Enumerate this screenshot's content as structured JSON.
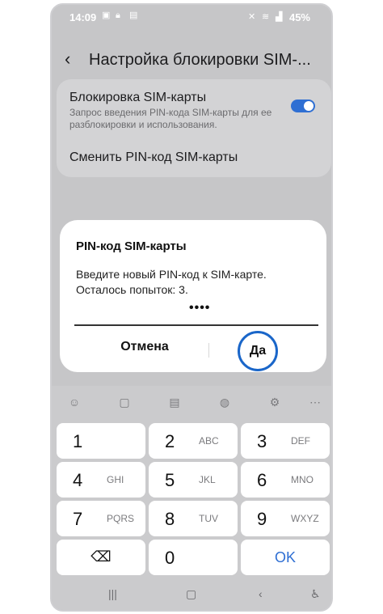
{
  "status": {
    "time": "14:09",
    "battery": "45%",
    "left_icons": [
      "sim-icon",
      "lock-icon",
      "image-icon"
    ],
    "right_icons": [
      "mute-icon",
      "wifi-icon",
      "signal-icon"
    ]
  },
  "header": {
    "title": "Настройка блокировки SIM-..."
  },
  "settings": {
    "lock_title": "Блокировка SIM-карты",
    "lock_sub": "Запрос введения PIN-кода SIM-карты для ее разблокировки и использования.",
    "change_pin": "Сменить PIN-код SIM-карты",
    "lock_enabled": true
  },
  "dialog": {
    "title": "PIN-код SIM-карты",
    "message_line1": "Введите новый PIN-код к SIM-карте.",
    "message_line2": "Осталось попыток: 3.",
    "pin_value": "••••",
    "cancel_label": "Отмена",
    "ok_label": "Да"
  },
  "keyboard": {
    "tools": [
      "emoji-icon",
      "clipboard-icon",
      "text-icon",
      "mic-icon",
      "settings-icon",
      "more-icon"
    ],
    "keys": [
      {
        "num": "1",
        "letters": ""
      },
      {
        "num": "2",
        "letters": "ABC"
      },
      {
        "num": "3",
        "letters": "DEF"
      },
      {
        "num": "4",
        "letters": "GHI"
      },
      {
        "num": "5",
        "letters": "JKL"
      },
      {
        "num": "6",
        "letters": "MNO"
      },
      {
        "num": "7",
        "letters": "PQRS"
      },
      {
        "num": "8",
        "letters": "TUV"
      },
      {
        "num": "9",
        "letters": "WXYZ"
      },
      {
        "num": "0",
        "letters": ""
      },
      {
        "num": "OK",
        "letters": ""
      }
    ]
  },
  "nav": [
    "recents-icon",
    "home-icon",
    "back-icon",
    "accessibility-icon"
  ]
}
